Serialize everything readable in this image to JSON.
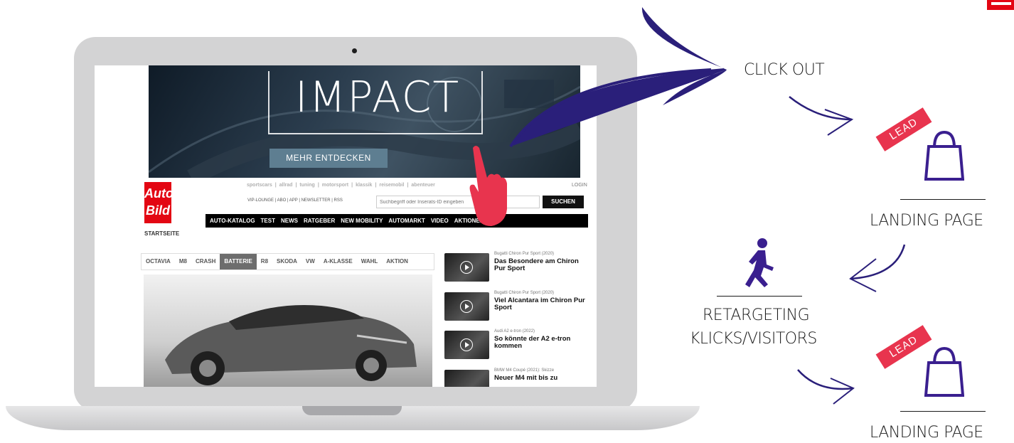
{
  "banner": {
    "title": "IMPACT",
    "button_label": "MEHR ENTDECKEN"
  },
  "site": {
    "logo_text": "Auto\nBild",
    "startseite": "STARTSEITE",
    "partner_links": [
      "sportscars",
      "allrad",
      "tuning",
      "motorsport",
      "klassik",
      "reisemobil",
      "abenteuer"
    ],
    "login": "LOGIN",
    "top_links": "VIP-LOUNGE | ABO | APP | NEWSLETTER | RSS",
    "search_placeholder": "Suchbegriff oder Inserats-ID eingeben",
    "search_button": "SUCHEN",
    "nav": [
      "AUTO-KATALOG",
      "TEST",
      "NEWS",
      "RATGEBER",
      "NEW MOBILITY",
      "AUTOMARKT",
      "VIDEO",
      "AKTIONEN"
    ],
    "tabs": [
      "OCTAVIA",
      "M8",
      "CRASH",
      "BATTERIE",
      "R8",
      "SKODA",
      "VW",
      "A-KLASSE",
      "WAHL",
      "AKTION"
    ],
    "active_tab": "BATTERIE",
    "teasers": [
      {
        "kicker": "Bugatti Chiron Pur Sport (2020)",
        "headline": "Das Besondere am Chiron Pur Sport"
      },
      {
        "kicker": "Bugatti Chiron Pur Sport (2020)",
        "headline": "Viel Alcantara im Chiron Pur Sport"
      },
      {
        "kicker": "Audi A2 e-tron (2022)",
        "headline": "So könnte der A2 e-tron kommen"
      },
      {
        "kicker": "BMW M4 Coupé (2021): Skizze",
        "headline": "Neuer M4 mit bis zu"
      }
    ]
  },
  "flow": {
    "click_out": "CLICK OUT",
    "lead_tag": "LEAD",
    "landing_page": "LANDING PAGE",
    "retargeting_line1": "RETARGETING",
    "retargeting_line2": "KLICKS/VISITORS"
  },
  "colors": {
    "accent_red": "#e8344e",
    "arrow_navy": "#2a1f7a",
    "icon_purple": "#3a1f8f",
    "laptop_grey": "#d3d3d4",
    "brand_red": "#e30613"
  },
  "icons": [
    "shopping-bag-icon",
    "running-person-icon",
    "pointing-hand-icon",
    "arrow-icon"
  ]
}
